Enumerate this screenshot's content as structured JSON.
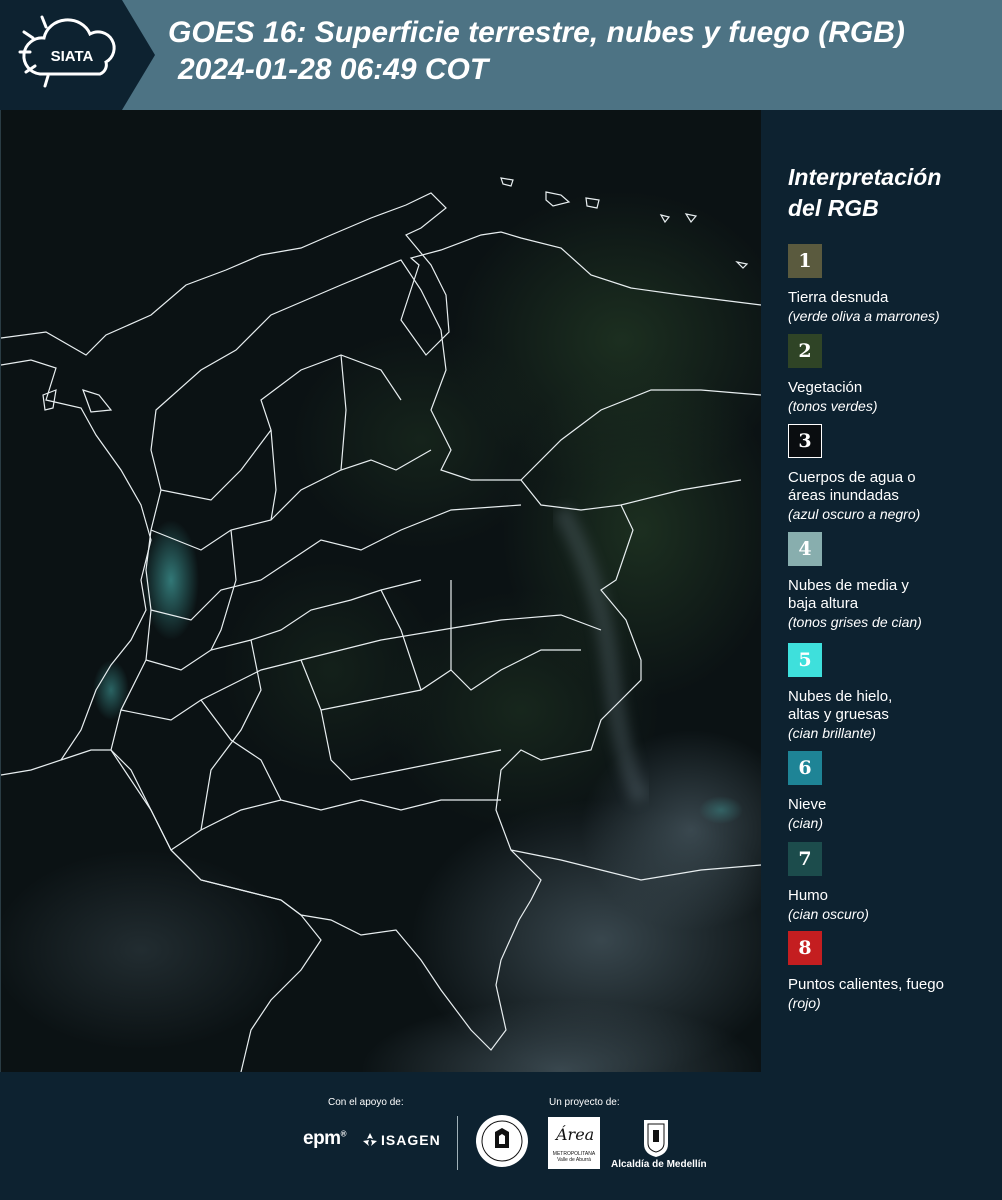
{
  "header": {
    "logo_text": "SIATA",
    "title_line1": "GOES 16: Superficie terrestre, nubes y fuego (RGB)",
    "title_line2": "2024-01-28 06:49 COT"
  },
  "legend": {
    "title_line1": "Interpretación",
    "title_line2": "del RGB",
    "items": [
      {
        "number": "1",
        "label": [
          "Tierra desnuda"
        ],
        "sub": "(verde oliva a marrones)",
        "color": "#5a5a3e",
        "text_color": "#ffffff"
      },
      {
        "number": "2",
        "label": [
          "Vegetación"
        ],
        "sub": "(tonos verdes)",
        "color": "#2f4426",
        "text_color": "#ffffff"
      },
      {
        "number": "3",
        "label": [
          "Cuerpos de agua o",
          "áreas inundadas"
        ],
        "sub": "(azul oscuro a negro)",
        "color": "#0a0d10",
        "text_color": "#ffffff"
      },
      {
        "number": "4",
        "label": [
          "Nubes de media y",
          "baja altura"
        ],
        "sub": "(tonos grises de cian)",
        "color": "#88aeae",
        "text_color": "#ffffff"
      },
      {
        "number": "5",
        "label": [
          "Nubes de hielo,",
          "altas y gruesas"
        ],
        "sub": "(cian brillante)",
        "color": "#3ee0dc",
        "text_color": "#ffffff"
      },
      {
        "number": "6",
        "label": [
          "Nieve"
        ],
        "sub": "(cian)",
        "color": "#1e8496",
        "text_color": "#ffffff"
      },
      {
        "number": "7",
        "label": [
          "Humo"
        ],
        "sub": "(cian oscuro)",
        "color": "#1c4c4c",
        "text_color": "#ffffff"
      },
      {
        "number": "8",
        "label": [
          "Puntos calientes, fuego"
        ],
        "sub": "(rojo)",
        "color": "#c41e20",
        "text_color": "#ffffff"
      }
    ]
  },
  "footer": {
    "support_caption": "Con el apoyo de:",
    "project_caption": "Un proyecto de:",
    "epm": "epm",
    "isagen": "ISAGEN",
    "area_logo_text": "Área",
    "area_logo_sub": "METROPOLITANA Valle de Aburrá",
    "alcaldia": "Alcaldía de Medellín"
  }
}
